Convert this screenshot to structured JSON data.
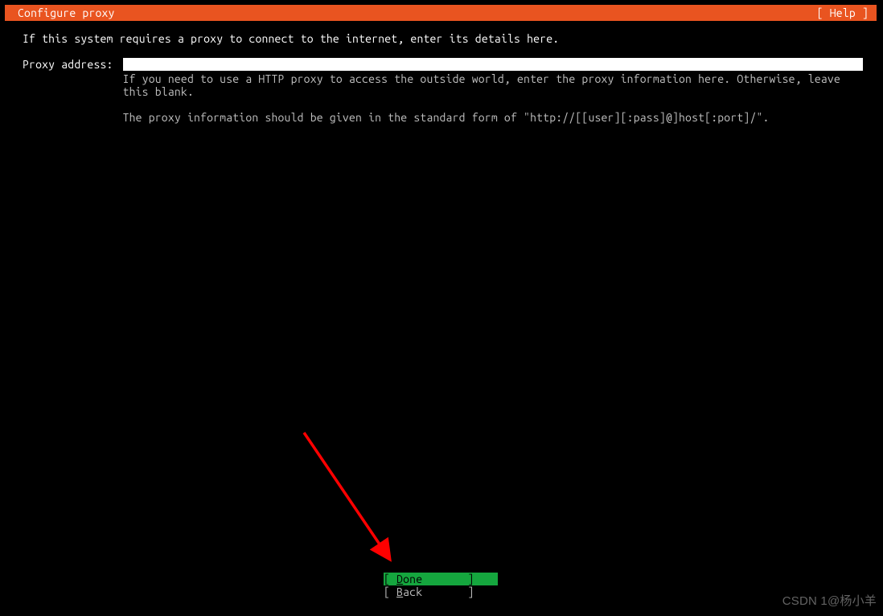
{
  "header": {
    "title": "Configure proxy",
    "help": "[ Help ]"
  },
  "instruction": "If this system requires a proxy to connect to the internet, enter its details here.",
  "proxy": {
    "label": "Proxy address:",
    "value": "",
    "hint1": "If you need to use a HTTP proxy to access the outside world, enter the proxy information here. Otherwise, leave this blank.",
    "hint2": "The proxy information should be given in the standard form of \"http://[[user][:pass]@]host[:port]/\"."
  },
  "footer": {
    "done_open": "[ ",
    "done_u": "D",
    "done_rest": "one       ",
    "done_close": "]",
    "back_open": "[ ",
    "back_u": "B",
    "back_rest": "ack       ",
    "back_close": "]"
  },
  "watermark": "CSDN 1@杨小羊"
}
